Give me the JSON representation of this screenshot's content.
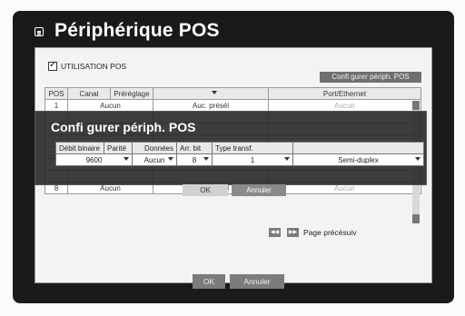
{
  "window": {
    "title": "Périphérique POS"
  },
  "options": {
    "use_pos_label": "UTILISATION POS",
    "configure_button": "Confi gurer périph. POS"
  },
  "table": {
    "headers": [
      "POS",
      "Canal",
      "Préréglage",
      "",
      "Port/Ethernet"
    ],
    "rows": [
      {
        "pos": "1",
        "channel": "Aucun",
        "preset": "Auc. présél",
        "port": "Aucun"
      },
      {
        "pos": "8",
        "channel": "Aucun",
        "preset": "Auc. présél",
        "port": "Aucun"
      }
    ]
  },
  "pagination": {
    "next_label": "Page précésuiv"
  },
  "footer": {
    "ok": "OK",
    "cancel": "Annuler"
  },
  "dialog": {
    "title": "Confi gurer périph. POS",
    "headers": [
      "Débit binaire",
      "Parité",
      "Données",
      "Arr. bit",
      "Type transf."
    ],
    "values": [
      "9600",
      "Aucun",
      "8",
      "1",
      "Semi-duplex"
    ],
    "ok": "OK",
    "cancel": "Annuler"
  }
}
